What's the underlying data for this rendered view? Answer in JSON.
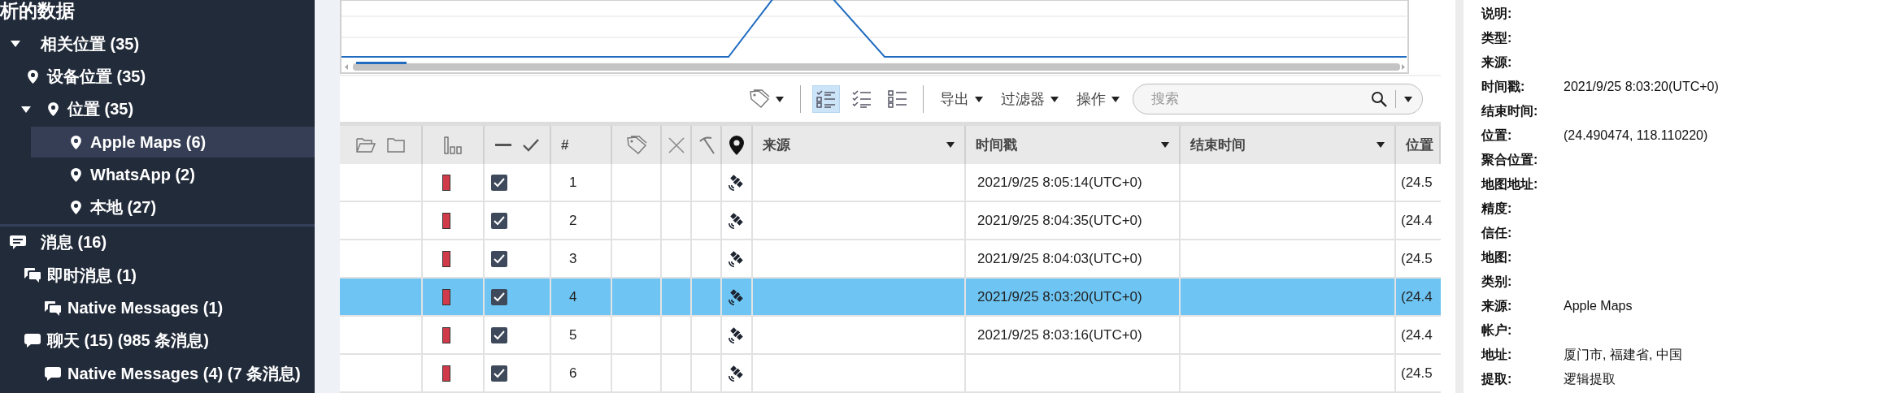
{
  "sidebar": {
    "title": "析的数据",
    "tree": [
      {
        "label": "相关位置 (35)",
        "kind": "group",
        "expanded": true,
        "selected": false,
        "children": [
          {
            "label": "设备位置 (35)",
            "kind": "pin",
            "selected": false,
            "children": [
              {
                "label": "位置 (35)",
                "kind": "pin",
                "expanded": true,
                "selected": false,
                "children": [
                  {
                    "label": "Apple Maps (6)",
                    "kind": "pin",
                    "selected": true
                  },
                  {
                    "label": "WhatsApp (2)",
                    "kind": "pin",
                    "selected": false
                  },
                  {
                    "label": "本地 (27)",
                    "kind": "pin",
                    "selected": false
                  }
                ]
              }
            ]
          }
        ]
      },
      {
        "label": "消息 (16)",
        "kind": "message",
        "selected": false,
        "children": [
          {
            "label": "即时消息 (1)",
            "kind": "im",
            "selected": false,
            "children": [
              {
                "label": "Native Messages (1)",
                "kind": "im",
                "selected": false
              }
            ]
          },
          {
            "label": "聊天 (15) (985 条消息)",
            "kind": "chat",
            "selected": false,
            "children": [
              {
                "label": "Native Messages (4) (7 条消息)",
                "kind": "chat",
                "selected": false
              }
            ]
          }
        ]
      }
    ]
  },
  "toolbar": {
    "views": [
      {
        "selected": true
      },
      {
        "selected": false
      },
      {
        "selected": false
      }
    ],
    "menus": [
      "导出",
      "过滤器",
      "操作"
    ],
    "search": {
      "placeholder": "搜索"
    }
  },
  "table": {
    "columns": [
      {
        "label": "#",
        "menu": false
      },
      {
        "label": "来源",
        "menu": true
      },
      {
        "label": "时间戳",
        "menu": true
      },
      {
        "label": "结束时间",
        "menu": true
      },
      {
        "label": "位置"
      }
    ],
    "rows": [
      {
        "checked": true,
        "selected": false,
        "number": "1",
        "timestamp": "2021/9/25 8:05:14(UTC+0)",
        "location": "(24.5"
      },
      {
        "checked": true,
        "selected": false,
        "number": "2",
        "timestamp": "2021/9/25 8:04:35(UTC+0)",
        "location": "(24.4"
      },
      {
        "checked": true,
        "selected": false,
        "number": "3",
        "timestamp": "2021/9/25 8:04:03(UTC+0)",
        "location": "(24.5"
      },
      {
        "checked": true,
        "selected": true,
        "number": "4",
        "timestamp": "2021/9/25 8:03:20(UTC+0)",
        "location": "(24.4"
      },
      {
        "checked": true,
        "selected": false,
        "number": "5",
        "timestamp": "2021/9/25 8:03:16(UTC+0)",
        "location": "(24.4"
      },
      {
        "checked": true,
        "selected": false,
        "number": "6",
        "location": "(24.5"
      }
    ]
  },
  "details": [
    {
      "label": "说明:"
    },
    {
      "label": "类型:"
    },
    {
      "label": "来源:"
    },
    {
      "label": "时间戳:",
      "value": "2021/9/25 8:03:20(UTC+0)"
    },
    {
      "label": "结束时间:"
    },
    {
      "label": "位置:",
      "value": "(24.490474, 118.110220)"
    },
    {
      "label": "聚合位置:"
    },
    {
      "label": "地图地址:"
    },
    {
      "label": "精度:"
    },
    {
      "label": "信任:"
    },
    {
      "label": "地图:"
    },
    {
      "label": "类别:"
    },
    {
      "label": "来源:",
      "value": "Apple Maps"
    },
    {
      "label": "帐户:"
    },
    {
      "label": "地址:",
      "value": "厦门市, 福建省, 中国"
    },
    {
      "label": "提取:",
      "value": "逻辑提取"
    }
  ]
}
